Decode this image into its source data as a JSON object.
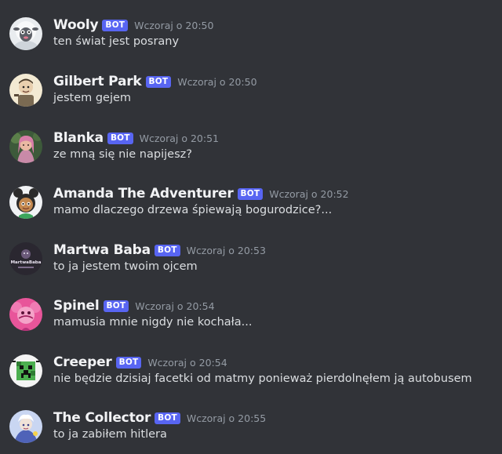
{
  "bot_tag": "BOT",
  "colors": {
    "background": "#313338",
    "name": "#f2f3f5",
    "text": "#dbdee1",
    "timestamp": "#949ba4",
    "bot_badge": "#5865f2"
  },
  "messages": [
    {
      "author": "Wooly",
      "timestamp": "Wczoraj o 20:50",
      "content": "ten świat jest posrany",
      "avatar": "sheep-avatar"
    },
    {
      "author": "Gilbert Park",
      "timestamp": "Wczoraj o 20:50",
      "content": "jestem gejem",
      "avatar": "cartoon-man-avatar"
    },
    {
      "author": "Blanka",
      "timestamp": "Wczoraj o 20:51",
      "content": "ze mną się nie napijesz?",
      "avatar": "pink-girl-avatar"
    },
    {
      "author": "Amanda The Adventurer",
      "timestamp": "Wczoraj o 20:52",
      "content": "mamo dlaczego drzewa śpiewają bogurodzice?...",
      "avatar": "doll-girl-avatar"
    },
    {
      "author": "Martwa Baba",
      "timestamp": "Wczoraj o 20:53",
      "content": "to ja jestem twoim ojcem",
      "avatar": "dark-text-avatar",
      "avatar_text": "MartwaBaba"
    },
    {
      "author": "Spinel",
      "timestamp": "Wczoraj o 20:54",
      "content": "mamusia mnie nigdy nie kochała...",
      "avatar": "pink-character-avatar"
    },
    {
      "author": "Creeper",
      "timestamp": "Wczoraj o 20:54",
      "content": "nie będzie dzisiaj facetki od matmy ponieważ pierdolnęłem ją autobusem",
      "avatar": "creeper-avatar"
    },
    {
      "author": "The Collector",
      "timestamp": "Wczoraj o 20:55",
      "content": "to ja zabiłem hitlera",
      "avatar": "collector-avatar"
    }
  ]
}
